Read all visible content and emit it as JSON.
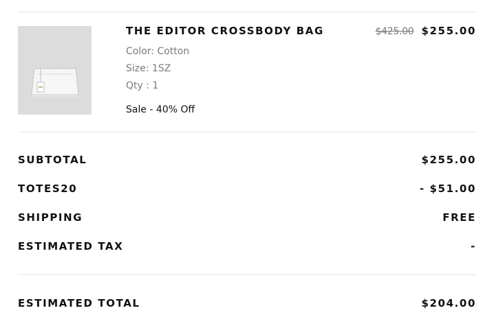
{
  "item": {
    "name": "THE EDITOR CROSSBODY BAG",
    "original_price": "$425.00",
    "sale_price": "$255.00",
    "color": "Color: Cotton",
    "size": "Size: 1SZ",
    "qty": "Qty : 1",
    "sale_note": "Sale - 40% Off",
    "image_icon": "handbag-product-image"
  },
  "summary": {
    "rows": [
      {
        "label": "SUBTOTAL",
        "value": "$255.00"
      },
      {
        "label": "TOTES20",
        "value": "- $51.00"
      },
      {
        "label": "SHIPPING",
        "value": "FREE"
      },
      {
        "label": "ESTIMATED TAX",
        "value": "-"
      }
    ],
    "total": {
      "label": "ESTIMATED TOTAL",
      "value": "$204.00"
    }
  },
  "colors": {
    "text": "#111111",
    "muted": "#7a7a7a",
    "divider": "#e6e6e6",
    "thumb_bg": "#dcdcdc"
  }
}
